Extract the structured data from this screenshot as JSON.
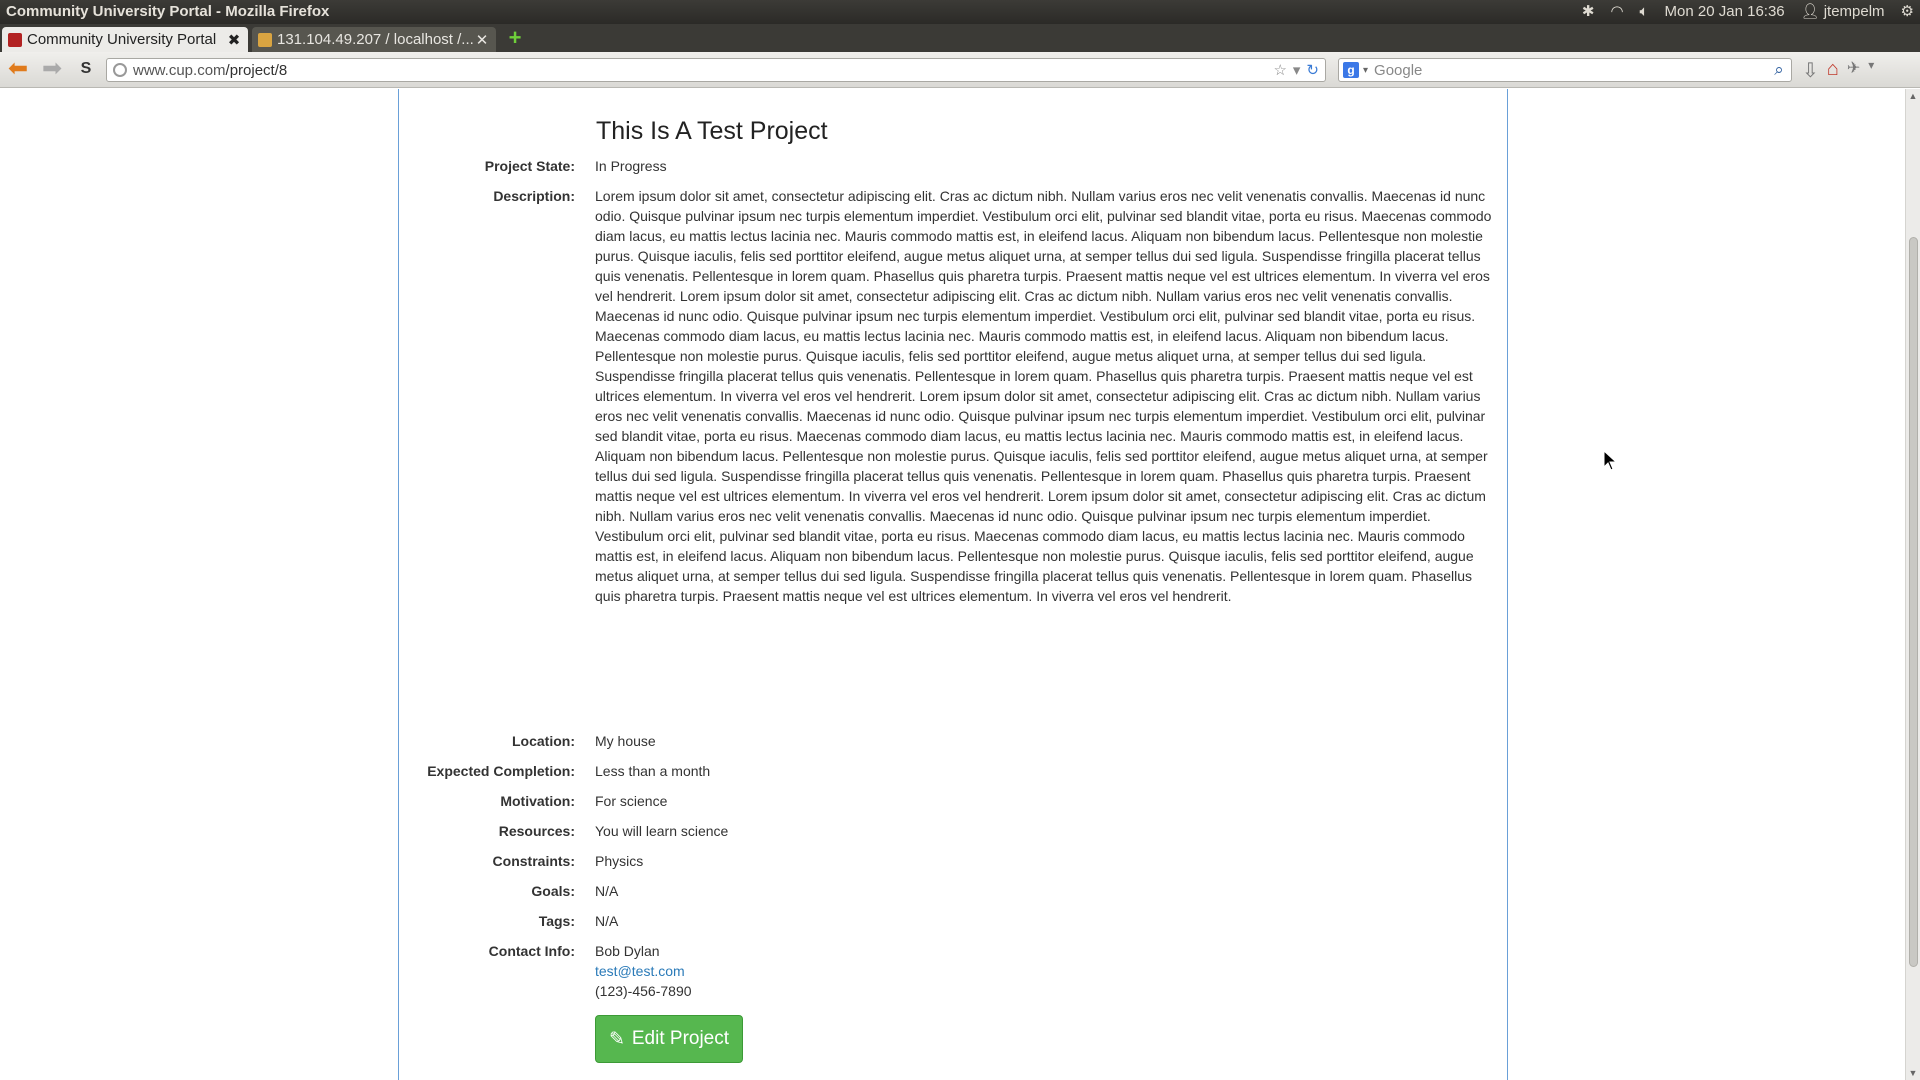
{
  "os": {
    "window_title": "Community University Portal - Mozilla Firefox",
    "clock": "Mon 20 Jan 16:36",
    "user": "jtempelm"
  },
  "tabs": [
    {
      "label": "Community University Portal",
      "active": true
    },
    {
      "label": "131.104.49.207 / localhost /...",
      "active": false
    }
  ],
  "nav": {
    "url_host": "www.cup.com",
    "url_path": "/project/8",
    "search_placeholder": "Google"
  },
  "project": {
    "title": "This Is A Test Project",
    "fields": {
      "state_label": "Project State:",
      "state_value": "In Progress",
      "description_label": "Description:",
      "description_value": "Lorem ipsum dolor sit amet, consectetur adipiscing elit. Cras ac dictum nibh. Nullam varius eros nec velit venenatis convallis. Maecenas id nunc odio. Quisque pulvinar ipsum nec turpis elementum imperdiet. Vestibulum orci elit, pulvinar sed blandit vitae, porta eu risus. Maecenas commodo diam lacus, eu mattis lectus lacinia nec. Mauris commodo mattis est, in eleifend lacus. Aliquam non bibendum lacus. Pellentesque non molestie purus. Quisque iaculis, felis sed porttitor eleifend, augue metus aliquet urna, at semper tellus dui sed ligula. Suspendisse fringilla placerat tellus quis venenatis. Pellentesque in lorem quam. Phasellus quis pharetra turpis. Praesent mattis neque vel est ultrices elementum. In viverra vel eros vel hendrerit. Lorem ipsum dolor sit amet, consectetur adipiscing elit. Cras ac dictum nibh. Nullam varius eros nec velit venenatis convallis. Maecenas id nunc odio. Quisque pulvinar ipsum nec turpis elementum imperdiet. Vestibulum orci elit, pulvinar sed blandit vitae, porta eu risus. Maecenas commodo diam lacus, eu mattis lectus lacinia nec. Mauris commodo mattis est, in eleifend lacus. Aliquam non bibendum lacus. Pellentesque non molestie purus. Quisque iaculis, felis sed porttitor eleifend, augue metus aliquet urna, at semper tellus dui sed ligula. Suspendisse fringilla placerat tellus quis venenatis. Pellentesque in lorem quam. Phasellus quis pharetra turpis. Praesent mattis neque vel est ultrices elementum. In viverra vel eros vel hendrerit. Lorem ipsum dolor sit amet, consectetur adipiscing elit. Cras ac dictum nibh. Nullam varius eros nec velit venenatis convallis. Maecenas id nunc odio. Quisque pulvinar ipsum nec turpis elementum imperdiet. Vestibulum orci elit, pulvinar sed blandit vitae, porta eu risus. Maecenas commodo diam lacus, eu mattis lectus lacinia nec. Mauris commodo mattis est, in eleifend lacus. Aliquam non bibendum lacus. Pellentesque non molestie purus. Quisque iaculis, felis sed porttitor eleifend, augue metus aliquet urna, at semper tellus dui sed ligula. Suspendisse fringilla placerat tellus quis venenatis. Pellentesque in lorem quam. Phasellus quis pharetra turpis. Praesent mattis neque vel est ultrices elementum. In viverra vel eros vel hendrerit. Lorem ipsum dolor sit amet, consectetur adipiscing elit. Cras ac dictum nibh. Nullam varius eros nec velit venenatis convallis. Maecenas id nunc odio. Quisque pulvinar ipsum nec turpis elementum imperdiet. Vestibulum orci elit, pulvinar sed blandit vitae, porta eu risus. Maecenas commodo diam lacus, eu mattis lectus lacinia nec. Mauris commodo mattis est, in eleifend lacus. Aliquam non bibendum lacus. Pellentesque non molestie purus. Quisque iaculis, felis sed porttitor eleifend, augue metus aliquet urna, at semper tellus dui sed ligula. Suspendisse fringilla placerat tellus quis venenatis. Pellentesque in lorem quam. Phasellus quis pharetra turpis. Praesent mattis neque vel est ultrices elementum. In viverra vel eros vel hendrerit.",
      "location_label": "Location:",
      "location_value": "My house",
      "completion_label": "Expected Completion:",
      "completion_value": "Less than a month",
      "motivation_label": "Motivation:",
      "motivation_value": "For science",
      "resources_label": "Resources:",
      "resources_value": "You will learn science",
      "constraints_label": "Constraints:",
      "constraints_value": "Physics",
      "goals_label": "Goals:",
      "goals_value": "N/A",
      "tags_label": "Tags:",
      "tags_value": "N/A",
      "contact_label": "Contact Info:",
      "contact_name": "Bob Dylan",
      "contact_email": "test@test.com",
      "contact_phone": "(123)-456-7890"
    },
    "edit_button": "Edit Project"
  },
  "colors": {
    "accent_button": "#56b74f",
    "link": "#2a7ab8",
    "container_border": "#6aa0d8"
  },
  "icons": {
    "edit": "pencil-icon",
    "back": "back-arrow-icon",
    "home": "home-icon"
  }
}
